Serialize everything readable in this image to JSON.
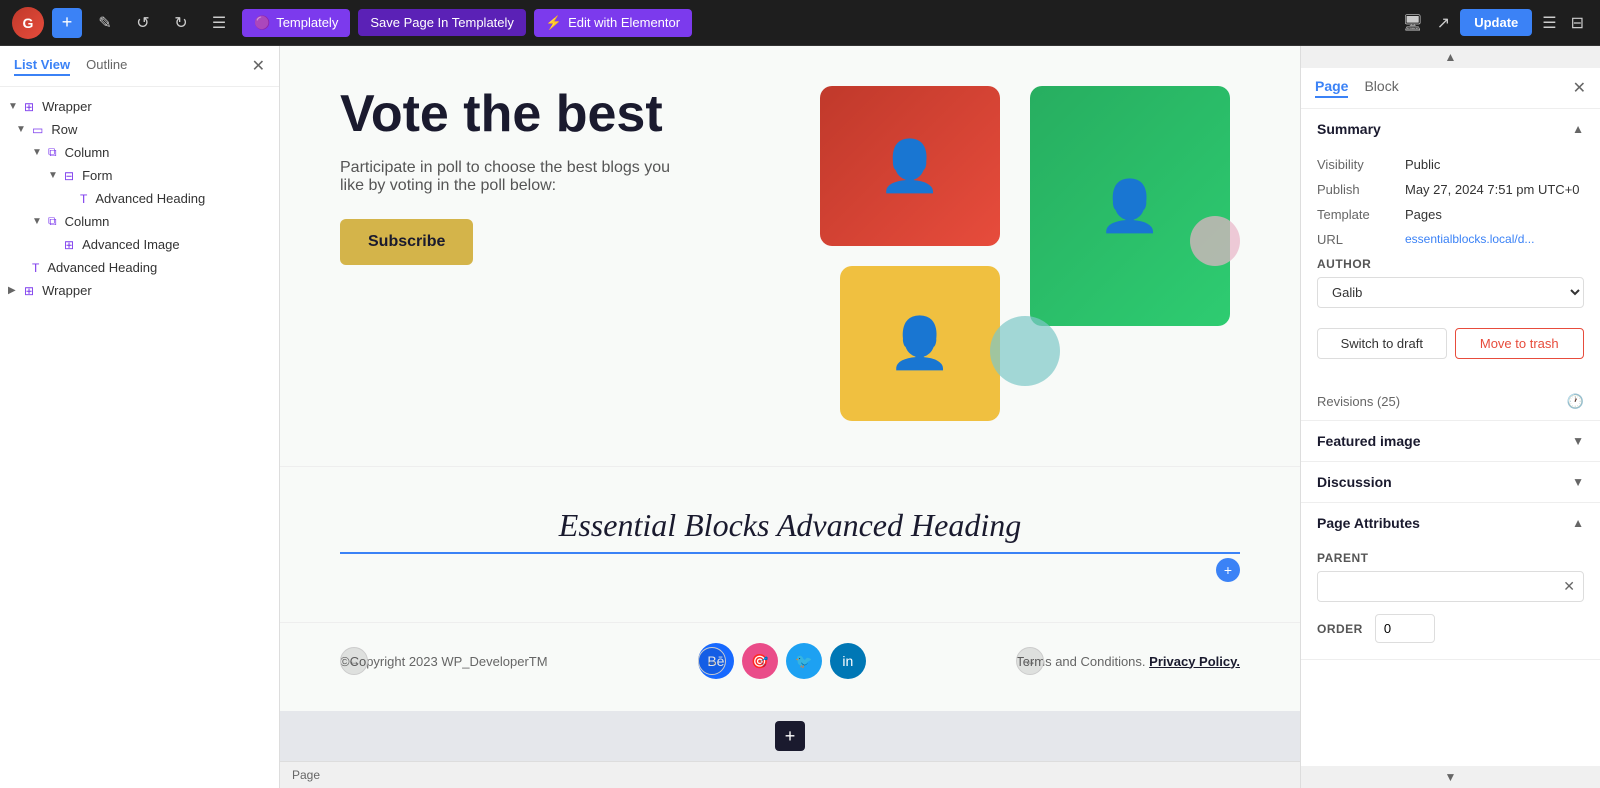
{
  "topbar": {
    "logo_text": "G",
    "btn_plus": "+",
    "btn_edit_label": "✎",
    "btn_undo": "↺",
    "btn_redo": "↻",
    "btn_list_view": "☰",
    "btn_templately": "Templately",
    "btn_save_templately": "Save Page In Templately",
    "btn_edit_elementor": "Edit with Elementor",
    "btn_update": "Update"
  },
  "sidebar": {
    "tab_list_view": "List View",
    "tab_outline": "Outline",
    "tree": [
      {
        "level": 0,
        "label": "Wrapper",
        "icon": "⊞",
        "toggle": "▼",
        "indent": 0
      },
      {
        "level": 1,
        "label": "Row",
        "icon": "▭",
        "toggle": "▼",
        "indent": 1
      },
      {
        "level": 2,
        "label": "Column",
        "icon": "⧉",
        "toggle": "▼",
        "indent": 2
      },
      {
        "level": 3,
        "label": "Form",
        "icon": "⊟",
        "toggle": "▼",
        "indent": 3
      },
      {
        "level": 4,
        "label": "Advanced Heading",
        "icon": "T",
        "toggle": "",
        "indent": 4
      },
      {
        "level": 2,
        "label": "Column",
        "icon": "⧉",
        "toggle": "▼",
        "indent": 2
      },
      {
        "level": 3,
        "label": "Advanced Image",
        "icon": "⊞",
        "toggle": "",
        "indent": 3
      },
      {
        "level": 1,
        "label": "Advanced Heading",
        "icon": "T",
        "toggle": "",
        "indent": 1
      },
      {
        "level": 0,
        "label": "Wrapper",
        "icon": "⊞",
        "toggle": "▶",
        "indent": 0
      }
    ]
  },
  "canvas": {
    "hero_title": "Vote the best",
    "hero_desc": "Participate in poll to choose the best blogs you like by voting in the poll below:",
    "subscribe_btn": "Subscribe",
    "advanced_heading": "Essential Blocks Advanced Heading",
    "footer_copyright": "©Copyright 2023 WP_DeveloperTM",
    "footer_links_text": "Terms and Conditions.",
    "footer_privacy": "Privacy Policy.",
    "social_icons": [
      "Bē",
      "🎯",
      "🐦",
      "in"
    ]
  },
  "right_panel": {
    "tab_page": "Page",
    "tab_block": "Block",
    "summary_title": "Summary",
    "visibility_label": "Visibility",
    "visibility_value": "Public",
    "publish_label": "Publish",
    "publish_value": "May 27, 2024 7:51 pm UTC+0",
    "template_label": "Template",
    "template_value": "Pages",
    "url_label": "URL",
    "url_value": "essentialblocks.local/d...",
    "author_label": "AUTHOR",
    "author_value": "Galib",
    "btn_switch_draft": "Switch to draft",
    "btn_move_trash": "Move to trash",
    "revisions_label": "Revisions (25)",
    "featured_image_label": "Featured image",
    "discussion_label": "Discussion",
    "page_attributes_label": "Page Attributes",
    "parent_label": "PARENT",
    "order_label": "ORDER",
    "order_value": "0"
  }
}
